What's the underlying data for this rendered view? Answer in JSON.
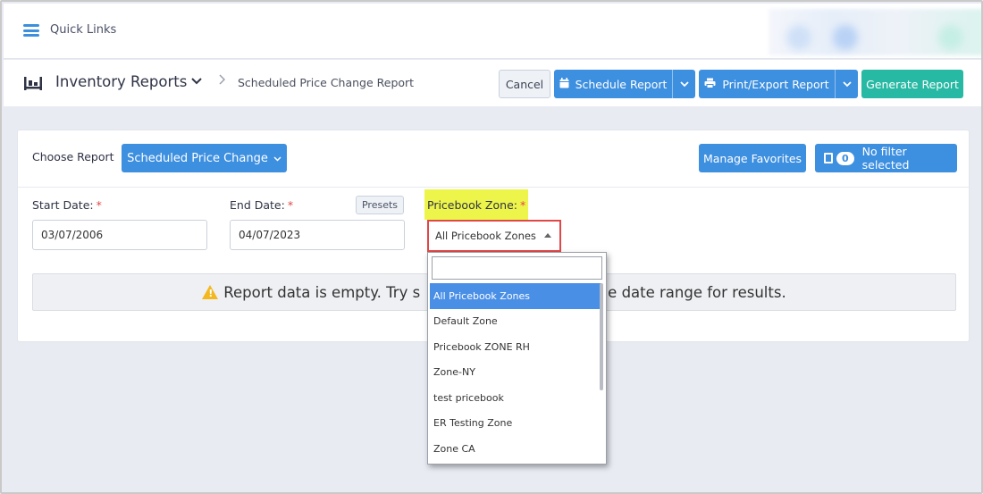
{
  "topbar": {
    "quick_links_label": "Quick Links"
  },
  "header": {
    "module_title": "Inventory Reports",
    "breadcrumb_current": "Scheduled Price Change Report",
    "cancel_label": "Cancel",
    "schedule_label": "Schedule Report",
    "print_export_label": "Print/Export Report",
    "generate_label": "Generate Report"
  },
  "report": {
    "choose_label": "Choose Report",
    "selected_report": "Scheduled Price Change",
    "manage_favorites_label": "Manage Favorites",
    "filter_count": "0",
    "filter_label": "No filter selected"
  },
  "fields": {
    "start_date_label": "Start Date:",
    "start_date_value": "03/07/2006",
    "end_date_label": "End Date:",
    "end_date_value": "04/07/2023",
    "presets_label": "Presets",
    "zone_label": "Pricebook Zone:",
    "zone_value": "All Pricebook Zones",
    "required_mark": "*"
  },
  "alert": {
    "text_before": "Report data is empty. Try s",
    "text_after": "e date range for results."
  },
  "zone_dropdown": {
    "search_value": "",
    "options": [
      "All Pricebook Zones",
      "Default Zone",
      "Pricebook ZONE RH",
      "Zone-NY",
      "test pricebook",
      "ER Testing Zone",
      "Zone CA"
    ],
    "selected": "All Pricebook Zones"
  },
  "colors": {
    "primary_blue": "#3d8fe0",
    "teal": "#27b9a3",
    "highlight_yellow": "#eef54a",
    "error_red": "#e04848",
    "selected_option": "#4a8fe6"
  }
}
